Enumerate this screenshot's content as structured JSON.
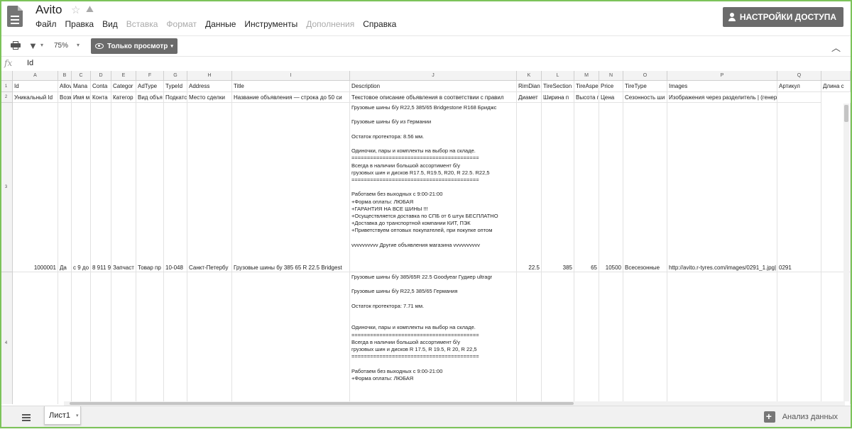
{
  "header": {
    "title": "Avito",
    "share_label": "НАСТРОЙКИ ДОСТУПА",
    "menu": [
      {
        "label": "Файл",
        "enabled": true
      },
      {
        "label": "Правка",
        "enabled": true
      },
      {
        "label": "Вид",
        "enabled": true
      },
      {
        "label": "Вставка",
        "enabled": false
      },
      {
        "label": "Формат",
        "enabled": false
      },
      {
        "label": "Данные",
        "enabled": true
      },
      {
        "label": "Инструменты",
        "enabled": true
      },
      {
        "label": "Дополнения",
        "enabled": false
      },
      {
        "label": "Справка",
        "enabled": true
      }
    ]
  },
  "toolbar": {
    "zoom": "75%",
    "view_mode": "Только просмотр"
  },
  "formula_bar": {
    "fx": "fx",
    "value": "Id"
  },
  "grid": {
    "columns": [
      "A",
      "B",
      "C",
      "D",
      "E",
      "F",
      "G",
      "H",
      "I",
      "J",
      "K",
      "L",
      "M",
      "N",
      "O",
      "P",
      "Q"
    ],
    "row_numbers": [
      "1",
      "2",
      "3",
      "4"
    ],
    "row1": [
      "Id",
      "Allov",
      "Mana",
      "Conta",
      "Categor",
      "AdType",
      "TypeId",
      "Address",
      "Title",
      "Description",
      "RimDian",
      "TireSection",
      "TireAspe",
      "Price",
      "TireType",
      "Images",
      "Артикул",
      "Длина с"
    ],
    "row2": [
      "Уникальный Id",
      "Возм",
      "Имя м",
      "Конта",
      "Категор",
      "Вид объя",
      "Подкатс",
      "Место сделки",
      "Название объявления — строка до 50 си",
      "Текстовое описание объявления в соответствии с правил",
      "Диамет",
      "Ширина п",
      "Высота п",
      "Цена",
      "Сезонность ши",
      "Изображения через разделитель | (генерируется автоматом в вид",
      ""
    ],
    "row3": [
      "1000001",
      "Да",
      "с 9 до",
      "8 911 9",
      "Запчаст",
      "Товар пр",
      "10-048",
      "Санкт-Петербу",
      "Грузовые шины бу 385 65 R 22.5 Bridgest",
      "",
      "22.5",
      "385",
      "65",
      "10500",
      "Всесезонные",
      "http://avito.r-tyres.com/images/0291_1.jpg|",
      "0291",
      ""
    ],
    "row3_description": "Грузовые шины б/у R22,5 385/65 Bridgestone R168 Бриджс\n\nГрузовые шины б/у из Германии\n\nОстаток протектора: 8.56 мм.\n\nОдиночки, пары и комплекты на выбор на складе.\n=========================================\nВсегда в наличии большой ассортимент б/у\nгрузовых шин и дисков R17.5, R19.5, R20, R 22.5. R22,5\n=========================================\n\nРаботаем без выходных с 9:00-21:00\n+Форма оплаты: ЛЮБАЯ\n+ГАРАНТИЯ НА ВСЕ ШИНЫ !!!\n+Осуществляется доставка по СПБ от 6 штук БЕСПЛАТНО\n+Доставка до транспортной компании КИТ, ПЭК\n+Приветствуем оптовых покупателей, при покупке оптом\n\nvvvvvvvvvv Другие объявления магазина vvvvvvvvvv",
    "row4_description": "Грузовые шины б/у 385/65R 22.5 Goodyear Гудиер ultragr\n\nГрузовые шины б/у R22,5 385/65 Германия\n\nОстаток протектора: 7.71 мм.\n\n\nОдиночки, пары и комплекты на выбор на складе.\n=========================================\nВсегда в наличии большой ассортимент б/у\nгрузовых шин и дисков R 17.5, R 19.5, R 20, R 22,5\n=========================================\n\nРаботаем без выходных с 9:00-21:00\n+Форма оплаты: ЛЮБАЯ"
  },
  "bottom": {
    "sheet_tab": "Лист1",
    "explore_label": "Анализ данных"
  }
}
